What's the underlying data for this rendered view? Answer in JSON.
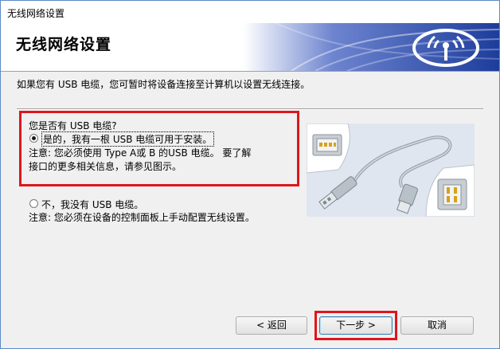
{
  "window": {
    "title": "无线网络设置"
  },
  "header": {
    "title": "无线网络设置"
  },
  "instruction": "如果您有 USB 电缆，您可暂时将设备连接至计算机以设置无线连接。",
  "question": "您是否有 USB 电缆?",
  "options": [
    {
      "label": "是的，我有一根 USB 电缆可用于安装。",
      "selected": true,
      "note_line1": "注意: 您必须使用 Type A或 B 的USB 电缆。 要了解",
      "note_line2": "接口的更多相关信息，请参见图示。"
    },
    {
      "label": "不，我没有 USB 电缆。",
      "selected": false,
      "note_line1": "注意: 您必须在设备的控制面板上手动配置无线设置。"
    }
  ],
  "buttons": {
    "back": "< 返回",
    "next": "下一步 >",
    "cancel": "取消"
  },
  "colors": {
    "highlight": "#e0151b",
    "banner_blue": "#1d3d9c"
  }
}
